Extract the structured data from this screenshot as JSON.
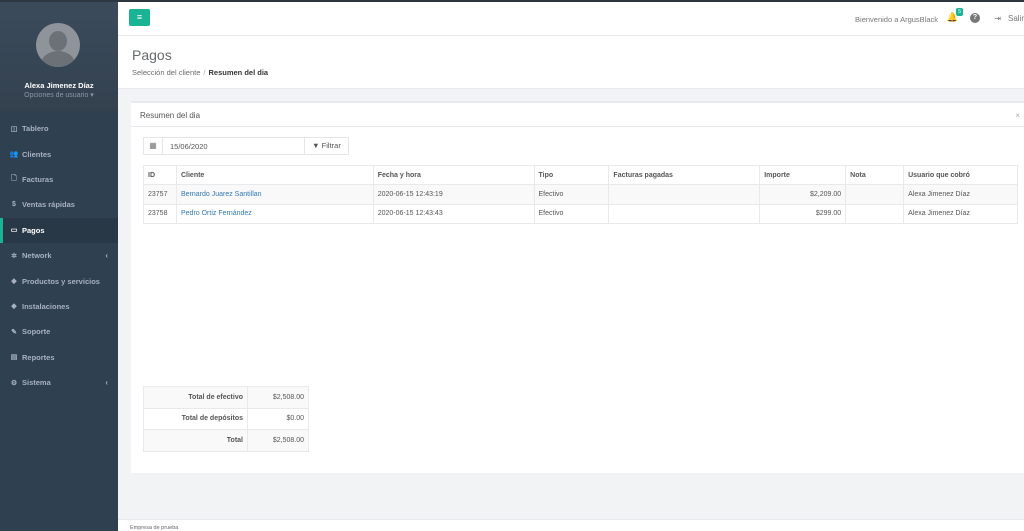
{
  "user": {
    "name": "Alexa Jimenez Díaz",
    "options": "Opciones de usuario ▾"
  },
  "sidebar": {
    "items": [
      {
        "label": "Tablero",
        "icon": "dashboard-icon",
        "glyph": "◫"
      },
      {
        "label": "Clientes",
        "icon": "users-icon",
        "glyph": "👥"
      },
      {
        "label": "Facturas",
        "icon": "file-icon",
        "glyph": "🗋"
      },
      {
        "label": "Ventas rápidas",
        "icon": "dollar-icon",
        "glyph": "$"
      },
      {
        "label": "Pagos",
        "icon": "money-icon",
        "glyph": "▭"
      },
      {
        "label": "Network",
        "icon": "network-icon",
        "glyph": "✲"
      },
      {
        "label": "Productos y servicios",
        "icon": "tag-icon",
        "glyph": "◆"
      },
      {
        "label": "Instalaciones",
        "icon": "tag-icon",
        "glyph": "◆"
      },
      {
        "label": "Soporte",
        "icon": "wrench-icon",
        "glyph": "✎"
      },
      {
        "label": "Reportes",
        "icon": "book-icon",
        "glyph": "▤"
      },
      {
        "label": "Sistema",
        "icon": "gears-icon",
        "glyph": "⚙"
      }
    ]
  },
  "topbar": {
    "welcome": "Bienvenido a ArgusBlack",
    "notification_count": "5",
    "help": "?",
    "logout": "Salir"
  },
  "heading": {
    "title": "Pagos",
    "breadcrumb_parent": "Selección del cliente",
    "breadcrumb_sep": "/",
    "breadcrumb_current": "Resumen del dia"
  },
  "panel": {
    "title": "Resumen del dia",
    "close": "×",
    "date_value": "15/06/2020",
    "filter_label": "Filtrar"
  },
  "table": {
    "headers": [
      "ID",
      "Cliente",
      "Fecha y hora",
      "Tipo",
      "Facturas pagadas",
      "Importe",
      "Nota",
      "Usuario que cobró"
    ],
    "rows": [
      {
        "id": "23757",
        "cliente": "Bernardo Juarez Santillan",
        "fecha": "2020-06-15 12:43:19",
        "tipo": "Efectivo",
        "facturas": "",
        "importe": "$2,209.00",
        "nota": "",
        "usuario": "Alexa Jimenez Díaz"
      },
      {
        "id": "23758",
        "cliente": "Pedro Ortiz Fernández",
        "fecha": "2020-06-15 12:43:43",
        "tipo": "Efectivo",
        "facturas": "",
        "importe": "$299.00",
        "nota": "",
        "usuario": "Alexa Jimenez Díaz"
      }
    ]
  },
  "totals": [
    {
      "label": "Total de efectivo",
      "value": "$2,508.00"
    },
    {
      "label": "Total de depósitos",
      "value": "$0.00"
    },
    {
      "label": "Total",
      "value": "$2,508.00"
    }
  ],
  "footer": {
    "text": "Empresa de prueba"
  },
  "colors": {
    "accent": "#1ab394",
    "sidebar": "#2f4050",
    "link": "#337ab7"
  }
}
